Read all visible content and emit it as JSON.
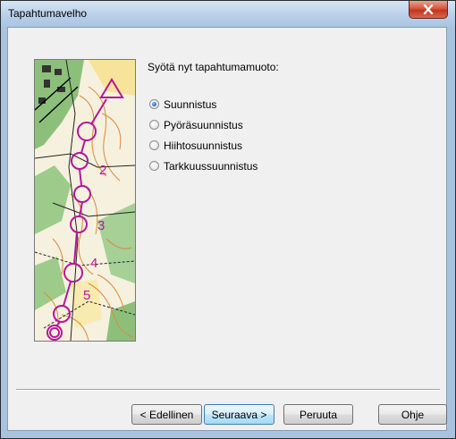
{
  "window": {
    "title": "Tapahtumavelho",
    "close_glyph": "X"
  },
  "content": {
    "prompt": "Syötä nyt tapahtumamuoto:",
    "options": [
      {
        "label": "Suunnistus",
        "checked": true
      },
      {
        "label": "Pyöräsuunnistus",
        "checked": false
      },
      {
        "label": "Hiihtosuunnistus",
        "checked": false
      },
      {
        "label": "Tarkkuussuunnistus",
        "checked": false
      }
    ],
    "map_numbers": [
      "2",
      "3",
      "4",
      "5"
    ]
  },
  "buttons": {
    "back": "< Edellinen",
    "next": "Seuraava >",
    "cancel": "Peruuta",
    "help": "Ohje"
  },
  "colors": {
    "course_magenta": "#b5169a",
    "map_green": "#7fb86a",
    "contour_brown": "#d9893a"
  }
}
